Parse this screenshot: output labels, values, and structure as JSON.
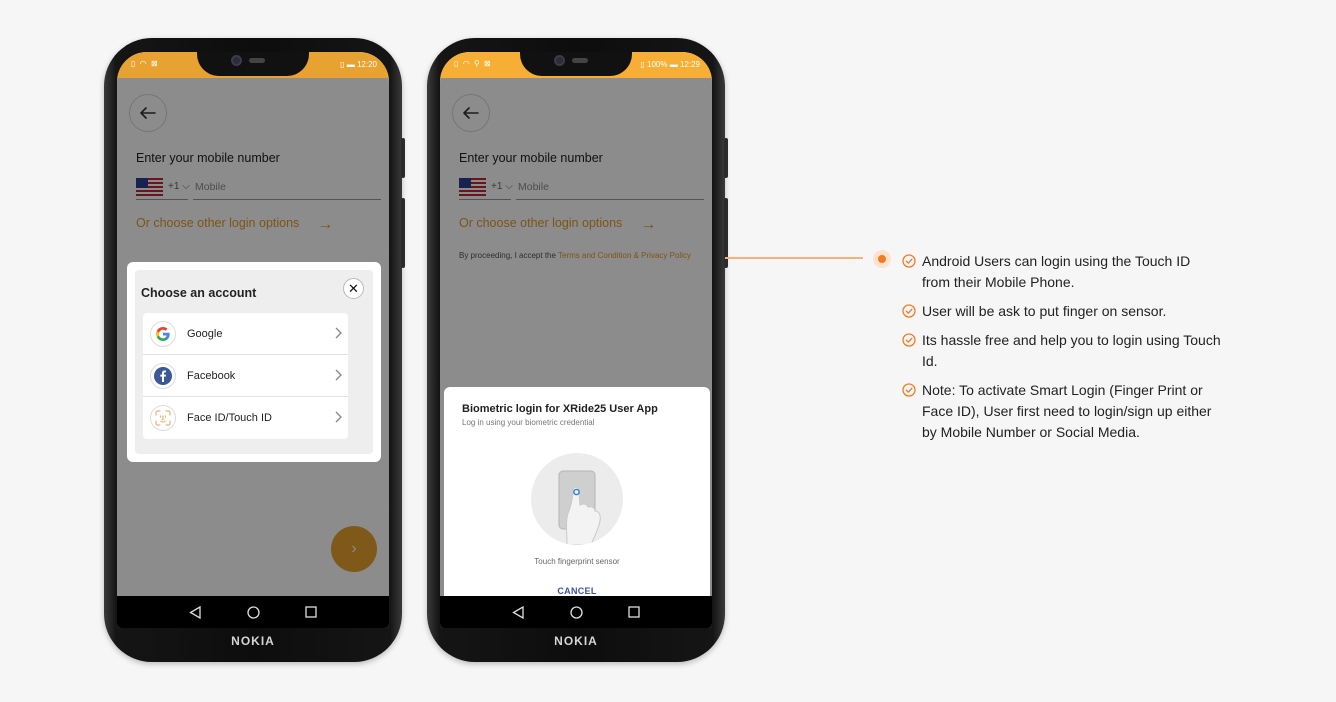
{
  "phone_left": {
    "status_time": "12:20",
    "prompt": "Enter your mobile number",
    "country_code": "+1",
    "mobile_placeholder": "Mobile",
    "other_login": "Or choose other login options",
    "brand": "NOKIA",
    "chooser": {
      "title": "Choose an account",
      "accounts": [
        {
          "label": "Google",
          "icon": "google-icon"
        },
        {
          "label": "Facebook",
          "icon": "facebook-icon"
        },
        {
          "label": "Face ID/Touch ID",
          "icon": "face-id-icon"
        }
      ]
    }
  },
  "phone_right": {
    "status_battery": "100%",
    "status_time": "12:29",
    "prompt": "Enter your mobile number",
    "country_code": "+1",
    "mobile_placeholder": "Mobile",
    "other_login": "Or choose other login options",
    "proceed_text": "By proceeding, I accept the",
    "proceed_link": "Terms and Condition & Privacy Policy",
    "brand": "NOKIA",
    "biometric": {
      "title": "Biometric login for XRide25 User App",
      "subtitle": "Log in using your biometric credential",
      "caption": "Touch fingerprint sensor",
      "cancel": "CANCEL"
    }
  },
  "features": [
    "Android Users can login using the Touch ID from their Mobile Phone.",
    "User will be ask to put finger on sensor.",
    "Its hassle free and help you to login using Touch Id.",
    "Note: To activate Smart Login (Finger Print or Face ID), User first need to login/sign up either by Mobile Number or Social Media."
  ],
  "colors": {
    "accent": "#f7ae34",
    "link": "#e39a2e",
    "callout": "#f37b23",
    "cancel": "#3a55a0"
  }
}
